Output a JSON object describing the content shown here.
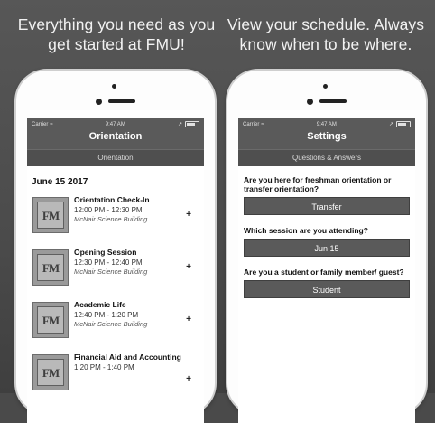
{
  "captions": {
    "left": "Everything you need as you get started at FMU!",
    "right": "View your schedule. Always know when to be where."
  },
  "status_bar": {
    "carrier": "Carrier",
    "time": "9:47 AM"
  },
  "left_screen": {
    "title": "Orientation",
    "subtitle": "Orientation",
    "date": "June 15 2017",
    "events": [
      {
        "title": "Orientation Check-In",
        "time": "12:00 PM - 12:30 PM",
        "location": "McNair Science Building",
        "logo": "FM"
      },
      {
        "title": "Opening Session",
        "time": "12:30 PM - 12:40 PM",
        "location": "McNair Science Building",
        "logo": "FM"
      },
      {
        "title": "Academic Life",
        "time": "12:40 PM - 1:20 PM",
        "location": "McNair Science Building",
        "logo": "FM"
      },
      {
        "title": "Financial Aid and Accounting",
        "time": "1:20 PM - 1:40 PM",
        "location": "",
        "logo": "FM"
      }
    ],
    "add_symbol": "+"
  },
  "right_screen": {
    "title": "Settings",
    "subtitle": "Questions & Answers",
    "questions": [
      {
        "question": "Are you here for freshman orientation or transfer orientation?",
        "answer": "Transfer"
      },
      {
        "question": "Which session are you attending?",
        "answer": "Jun 15"
      },
      {
        "question": "Are you a student or family member/ guest?",
        "answer": "Student"
      }
    ]
  },
  "colors": {
    "background": "#4a4a4a",
    "navbar": "#5a5a5a",
    "answer_button": "#5a5a5a"
  }
}
